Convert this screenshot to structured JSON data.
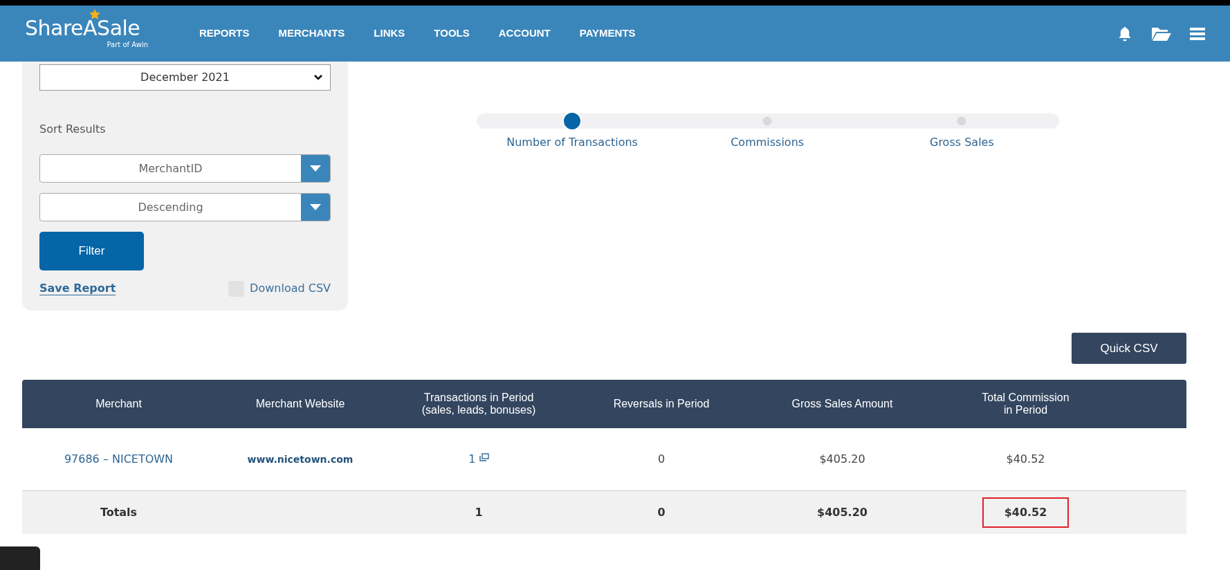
{
  "header": {
    "logo": {
      "name": "ShareASale",
      "tagline": "Part of Awin"
    },
    "nav": [
      {
        "label": "REPORTS"
      },
      {
        "label": "MERCHANTS"
      },
      {
        "label": "LINKS"
      },
      {
        "label": "TOOLS"
      },
      {
        "label": "ACCOUNT"
      },
      {
        "label": "PAYMENTS"
      }
    ]
  },
  "filters": {
    "period": {
      "value": "December 2021"
    },
    "sort_label": "Sort Results",
    "sort_selects": [
      {
        "value": "MerchantID"
      },
      {
        "value": "Descending"
      }
    ],
    "filter_button": "Filter",
    "save_report": "Save Report",
    "download_csv": {
      "label": "Download CSV",
      "checked": false
    }
  },
  "stepper": [
    {
      "label": "Number of Transactions",
      "selected": true
    },
    {
      "label": "Commissions",
      "selected": false
    },
    {
      "label": "Gross Sales",
      "selected": false
    }
  ],
  "quick_csv": "Quick CSV",
  "table": {
    "columns": [
      "Merchant",
      "Merchant Website",
      "Transactions in Period\n(sales, leads, bonuses)",
      "Reversals in Period",
      "Gross Sales Amount",
      "Total Commission\nin Period"
    ],
    "rows": [
      {
        "cells": [
          {
            "text": "97686 – NICETOWN",
            "kind": "link"
          },
          {
            "text": "www.nicetown.com",
            "kind": "site"
          },
          {
            "text": "1",
            "kind": "popup"
          },
          {
            "text": "0",
            "kind": "text"
          },
          {
            "text": "$405.20",
            "kind": "text"
          },
          {
            "text": "$40.52",
            "kind": "text"
          }
        ]
      }
    ],
    "totals": {
      "label": "Totals",
      "cells": [
        {
          "text": "1",
          "highlighted": false
        },
        {
          "text": "0",
          "highlighted": false
        },
        {
          "text": "$405.20",
          "highlighted": false
        },
        {
          "text": "$40.52",
          "highlighted": true
        }
      ]
    }
  }
}
